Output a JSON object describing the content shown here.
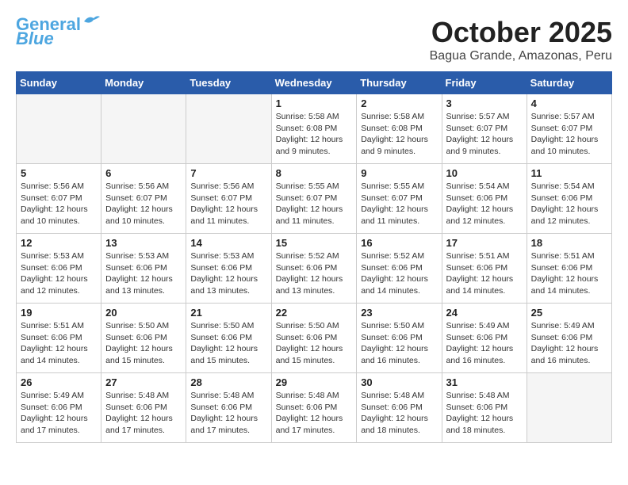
{
  "header": {
    "logo_line1": "General",
    "logo_line2": "Blue",
    "month": "October 2025",
    "location": "Bagua Grande, Amazonas, Peru"
  },
  "weekdays": [
    "Sunday",
    "Monday",
    "Tuesday",
    "Wednesday",
    "Thursday",
    "Friday",
    "Saturday"
  ],
  "weeks": [
    [
      {
        "day": "",
        "info": ""
      },
      {
        "day": "",
        "info": ""
      },
      {
        "day": "",
        "info": ""
      },
      {
        "day": "1",
        "info": "Sunrise: 5:58 AM\nSunset: 6:08 PM\nDaylight: 12 hours and 9 minutes."
      },
      {
        "day": "2",
        "info": "Sunrise: 5:58 AM\nSunset: 6:08 PM\nDaylight: 12 hours and 9 minutes."
      },
      {
        "day": "3",
        "info": "Sunrise: 5:57 AM\nSunset: 6:07 PM\nDaylight: 12 hours and 9 minutes."
      },
      {
        "day": "4",
        "info": "Sunrise: 5:57 AM\nSunset: 6:07 PM\nDaylight: 12 hours and 10 minutes."
      }
    ],
    [
      {
        "day": "5",
        "info": "Sunrise: 5:56 AM\nSunset: 6:07 PM\nDaylight: 12 hours and 10 minutes."
      },
      {
        "day": "6",
        "info": "Sunrise: 5:56 AM\nSunset: 6:07 PM\nDaylight: 12 hours and 10 minutes."
      },
      {
        "day": "7",
        "info": "Sunrise: 5:56 AM\nSunset: 6:07 PM\nDaylight: 12 hours and 11 minutes."
      },
      {
        "day": "8",
        "info": "Sunrise: 5:55 AM\nSunset: 6:07 PM\nDaylight: 12 hours and 11 minutes."
      },
      {
        "day": "9",
        "info": "Sunrise: 5:55 AM\nSunset: 6:07 PM\nDaylight: 12 hours and 11 minutes."
      },
      {
        "day": "10",
        "info": "Sunrise: 5:54 AM\nSunset: 6:06 PM\nDaylight: 12 hours and 12 minutes."
      },
      {
        "day": "11",
        "info": "Sunrise: 5:54 AM\nSunset: 6:06 PM\nDaylight: 12 hours and 12 minutes."
      }
    ],
    [
      {
        "day": "12",
        "info": "Sunrise: 5:53 AM\nSunset: 6:06 PM\nDaylight: 12 hours and 12 minutes."
      },
      {
        "day": "13",
        "info": "Sunrise: 5:53 AM\nSunset: 6:06 PM\nDaylight: 12 hours and 13 minutes."
      },
      {
        "day": "14",
        "info": "Sunrise: 5:53 AM\nSunset: 6:06 PM\nDaylight: 12 hours and 13 minutes."
      },
      {
        "day": "15",
        "info": "Sunrise: 5:52 AM\nSunset: 6:06 PM\nDaylight: 12 hours and 13 minutes."
      },
      {
        "day": "16",
        "info": "Sunrise: 5:52 AM\nSunset: 6:06 PM\nDaylight: 12 hours and 14 minutes."
      },
      {
        "day": "17",
        "info": "Sunrise: 5:51 AM\nSunset: 6:06 PM\nDaylight: 12 hours and 14 minutes."
      },
      {
        "day": "18",
        "info": "Sunrise: 5:51 AM\nSunset: 6:06 PM\nDaylight: 12 hours and 14 minutes."
      }
    ],
    [
      {
        "day": "19",
        "info": "Sunrise: 5:51 AM\nSunset: 6:06 PM\nDaylight: 12 hours and 14 minutes."
      },
      {
        "day": "20",
        "info": "Sunrise: 5:50 AM\nSunset: 6:06 PM\nDaylight: 12 hours and 15 minutes."
      },
      {
        "day": "21",
        "info": "Sunrise: 5:50 AM\nSunset: 6:06 PM\nDaylight: 12 hours and 15 minutes."
      },
      {
        "day": "22",
        "info": "Sunrise: 5:50 AM\nSunset: 6:06 PM\nDaylight: 12 hours and 15 minutes."
      },
      {
        "day": "23",
        "info": "Sunrise: 5:50 AM\nSunset: 6:06 PM\nDaylight: 12 hours and 16 minutes."
      },
      {
        "day": "24",
        "info": "Sunrise: 5:49 AM\nSunset: 6:06 PM\nDaylight: 12 hours and 16 minutes."
      },
      {
        "day": "25",
        "info": "Sunrise: 5:49 AM\nSunset: 6:06 PM\nDaylight: 12 hours and 16 minutes."
      }
    ],
    [
      {
        "day": "26",
        "info": "Sunrise: 5:49 AM\nSunset: 6:06 PM\nDaylight: 12 hours and 17 minutes."
      },
      {
        "day": "27",
        "info": "Sunrise: 5:48 AM\nSunset: 6:06 PM\nDaylight: 12 hours and 17 minutes."
      },
      {
        "day": "28",
        "info": "Sunrise: 5:48 AM\nSunset: 6:06 PM\nDaylight: 12 hours and 17 minutes."
      },
      {
        "day": "29",
        "info": "Sunrise: 5:48 AM\nSunset: 6:06 PM\nDaylight: 12 hours and 17 minutes."
      },
      {
        "day": "30",
        "info": "Sunrise: 5:48 AM\nSunset: 6:06 PM\nDaylight: 12 hours and 18 minutes."
      },
      {
        "day": "31",
        "info": "Sunrise: 5:48 AM\nSunset: 6:06 PM\nDaylight: 12 hours and 18 minutes."
      },
      {
        "day": "",
        "info": ""
      }
    ]
  ]
}
